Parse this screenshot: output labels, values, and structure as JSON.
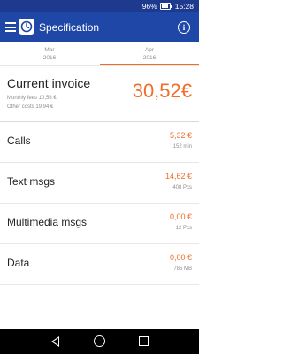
{
  "status_bar": {
    "battery": "96%",
    "battery_level": 0.96,
    "time": "15:28"
  },
  "app_bar": {
    "title": "Specification"
  },
  "tabs": [
    {
      "month": "Mar",
      "year": "2016",
      "selected": false
    },
    {
      "month": "Apr",
      "year": "2016",
      "selected": true
    }
  ],
  "invoice": {
    "label": "Current invoice",
    "amount": "30,52€",
    "monthly_fees": "Monthly fees 10,58 €",
    "other_costs": "Other costs 19,94 €"
  },
  "rows": [
    {
      "label": "Calls",
      "amount": "5,32 €",
      "sub": "152 min"
    },
    {
      "label": "Text msgs",
      "amount": "14,62 €",
      "sub": "408 Pcs"
    },
    {
      "label": "Multimedia msgs",
      "amount": "0,00 €",
      "sub": "12 Pcs"
    },
    {
      "label": "Data",
      "amount": "0,00 €",
      "sub": "785 MB"
    }
  ],
  "colors": {
    "app_bar": "#1f47a8",
    "status_bar": "#1e3a8e",
    "accent": "#f26c2a"
  },
  "icons": {
    "menu": "menu-icon",
    "app": "app-logo-icon",
    "info": "info-icon",
    "back": "back-icon",
    "home": "home-icon",
    "recent": "recent-apps-icon"
  }
}
